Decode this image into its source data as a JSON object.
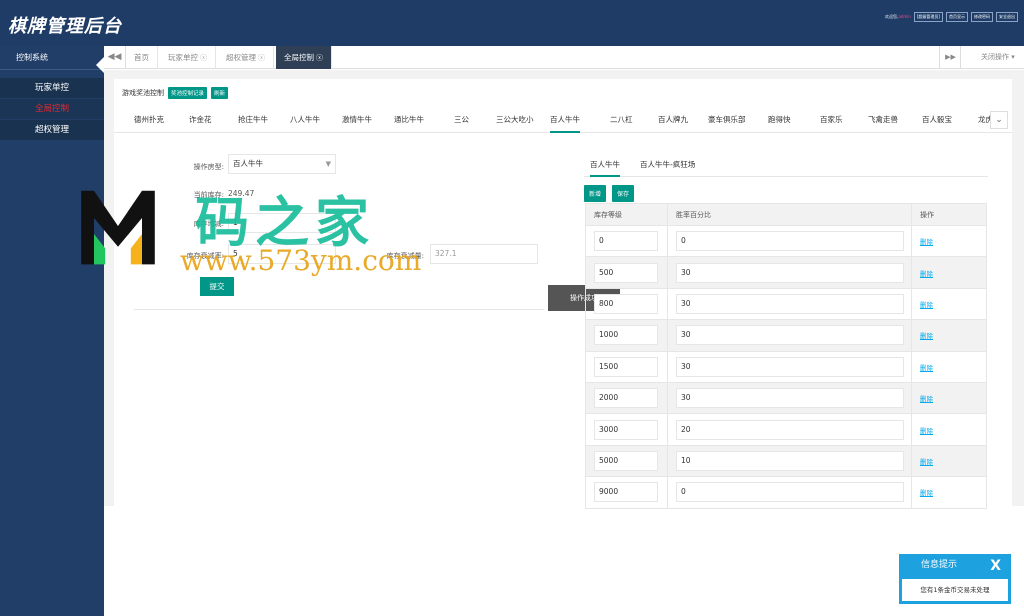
{
  "header": {
    "logo": "棋牌管理后台",
    "welcome_prefix": "欢迎您,",
    "username": "admin",
    "links": [
      "[超级管理员]",
      "首页显示",
      "修改密码",
      "安全退出"
    ]
  },
  "sidebar": {
    "title": "控制系统",
    "items": [
      {
        "label": "玩家单控"
      },
      {
        "label": "全局控制"
      },
      {
        "label": "超权管理"
      }
    ]
  },
  "tabsbar": {
    "tabs": [
      "首页",
      "玩家单控",
      "超权管理",
      "全局控制"
    ],
    "close_ops": "关闭操作"
  },
  "panel": {
    "title": "游戏奖池控制",
    "record_button": "奖池控制记录",
    "refresh_button": "刷新",
    "game_tabs": [
      "德州扑克",
      "诈金花",
      "抢庄牛牛",
      "八人牛牛",
      "激情牛牛",
      "通比牛牛",
      "三公",
      "三公大吃小",
      "百人牛牛",
      "二八杠",
      "百人牌九",
      "豪车俱乐部",
      "跑得快",
      "百家乐",
      "飞禽走兽",
      "百人骰宝",
      "龙虎"
    ]
  },
  "form": {
    "room_label": "操作房型:",
    "room_value": "百人牛牛",
    "stock_label": "当前库存:",
    "stock_value": "249.47",
    "inc_label": "库存增减:",
    "inc_value": "1",
    "decay_rate_label": "库存衰减率:",
    "decay_rate_value": "5",
    "decay_amount_label": "库存衰减量:",
    "decay_amount_value": "327.1",
    "submit": "提交"
  },
  "toast": "操作成功",
  "right": {
    "sub_tabs": [
      "百人牛牛",
      "百人牛牛-疯狂场"
    ],
    "add_button": "新增",
    "save_button": "保存",
    "table": {
      "headers": [
        "库存等级",
        "胜率百分比",
        "操作"
      ],
      "rows": [
        {
          "level": "0",
          "rate": "0",
          "op": "删除"
        },
        {
          "level": "500",
          "rate": "30",
          "op": "删除"
        },
        {
          "level": "800",
          "rate": "30",
          "op": "删除"
        },
        {
          "level": "1000",
          "rate": "30",
          "op": "删除"
        },
        {
          "level": "1500",
          "rate": "30",
          "op": "删除"
        },
        {
          "level": "2000",
          "rate": "30",
          "op": "删除"
        },
        {
          "level": "3000",
          "rate": "20",
          "op": "删除"
        },
        {
          "level": "5000",
          "rate": "10",
          "op": "删除"
        },
        {
          "level": "9000",
          "rate": "0",
          "op": "删除"
        }
      ]
    }
  },
  "watermark": {
    "cn": "码之家",
    "url": "www.573ym.com"
  },
  "info": {
    "title": "信息提示",
    "close": "X",
    "message": "您有1条金币交易未处理"
  }
}
